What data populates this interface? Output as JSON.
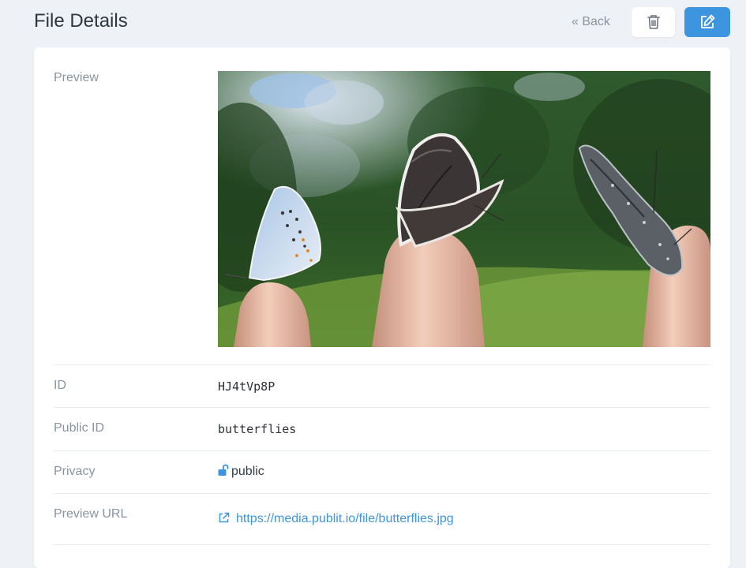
{
  "header": {
    "title": "File Details",
    "back_label": "« Back"
  },
  "details": {
    "preview_label": "Preview",
    "id_label": "ID",
    "id_value": "HJ4tVp8P",
    "public_id_label": "Public ID",
    "public_id_value": "butterflies",
    "privacy_label": "Privacy",
    "privacy_value": "public",
    "preview_url_label": "Preview URL",
    "preview_url_value": "https://media.publit.io/file/butterflies.jpg"
  },
  "icons": {
    "delete": "trash-icon",
    "edit": "edit-icon",
    "privacy": "unlock-icon",
    "link": "external-link-icon"
  },
  "colors": {
    "accent": "#3d95e0",
    "background": "#eef1f5",
    "card": "#ffffff"
  }
}
